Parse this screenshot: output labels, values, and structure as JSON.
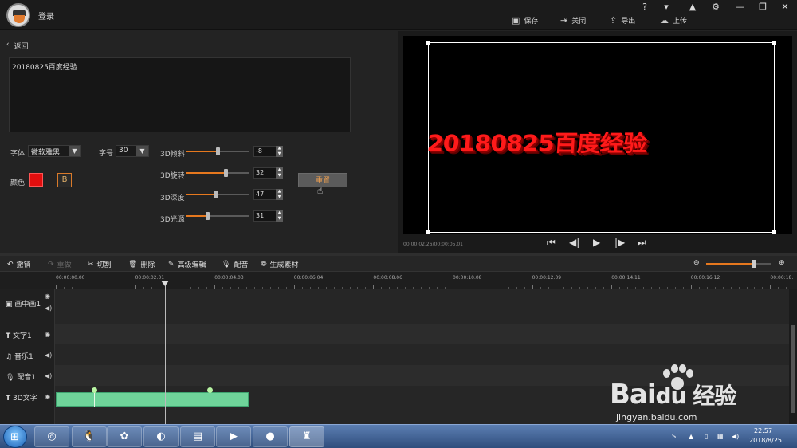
{
  "titlebar": {
    "login": "登录",
    "actions": {
      "save": "保存",
      "close": "关闭",
      "export": "导出",
      "upload": "上传"
    },
    "controls": [
      "?",
      "▾",
      "▲",
      "⚙",
      "—",
      "❐",
      "✕"
    ]
  },
  "edit": {
    "back": "返回",
    "text_value": "20180825百度经验",
    "font_label": "字体",
    "font_value": "微软雅黑",
    "size_label": "字号",
    "size_value": "30",
    "color_label": "颜色",
    "color_value": "#e20e0e",
    "bold_label": "B",
    "reset_label": "重置",
    "sliders": [
      {
        "label": "3D倾斜",
        "value": "-8",
        "fraction": 0.5
      },
      {
        "label": "3D旋转",
        "value": "32",
        "fraction": 0.62
      },
      {
        "label": "3D深度",
        "value": "47",
        "fraction": 0.47
      },
      {
        "label": "3D光源",
        "value": "31",
        "fraction": 0.34
      }
    ]
  },
  "preview": {
    "text": "20180825百度经验",
    "timecode": "00:00:02.26/00:00:05.01"
  },
  "toolbar": {
    "undo": "撤销",
    "redo": "重做",
    "cut": "切割",
    "delete": "删除",
    "advanced": "高级编辑",
    "dub": "配音",
    "generate": "生成素材",
    "zoom_fraction": 0.73
  },
  "ruler": {
    "labels": [
      "00:00:00.00",
      "00:00:02.01",
      "00:00:04.03",
      "00:00:06.04",
      "00:00:08.06",
      "00:00:10.08",
      "00:00:12.09",
      "00:00:14.11",
      "00:00:16.12",
      "00:00:18."
    ]
  },
  "tracks": {
    "pip": "画中画1",
    "text": "文字1",
    "music": "音乐1",
    "dub": "配音1",
    "text3d": "3D文字"
  },
  "taskbar": {
    "time": "22:57",
    "date": "2018/8/25"
  },
  "watermark": {
    "logo": "Bai",
    "logo2": "du 经验",
    "url": "jingyan.baidu.com"
  }
}
